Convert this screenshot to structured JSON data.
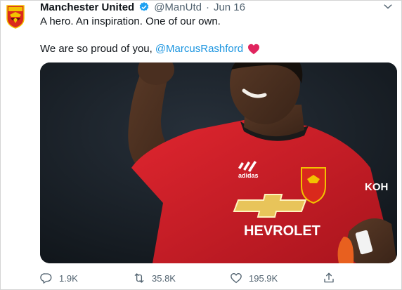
{
  "tweet": {
    "author_name": "Manchester United",
    "handle": "@ManUtd",
    "separator": "·",
    "date": "Jun 16",
    "line1": "A hero. An inspiration. One of our own.",
    "line2": "We are so proud of you,",
    "mention": "@MarcusRashford"
  },
  "image": {
    "sponsor": "HEVROLET",
    "sleeve_text": "KOH",
    "brand": "adidas"
  },
  "actions": {
    "replies": "1.9K",
    "retweets": "35.8K",
    "likes": "195.9K"
  },
  "colors": {
    "link": "#1b95e0",
    "heart": "#e0245e",
    "verified": "#1da1f2",
    "shirt": "#d3202b"
  }
}
